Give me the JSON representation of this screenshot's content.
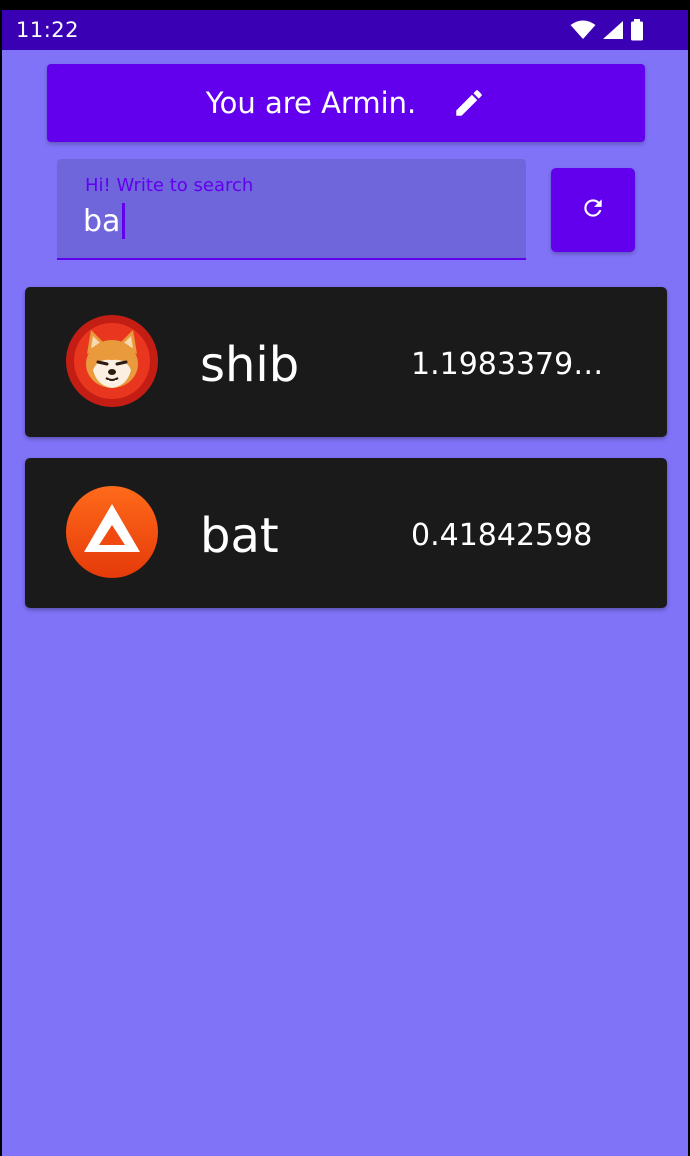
{
  "status_bar": {
    "time": "11:22",
    "icons": [
      "wifi-icon",
      "signal-icon",
      "battery-icon"
    ]
  },
  "header": {
    "name_label": "You are Armin.",
    "edit_icon": "pencil-icon"
  },
  "search": {
    "label": "Hi! Write to search",
    "value": "ba"
  },
  "refresh": {
    "icon": "refresh-icon"
  },
  "coins": [
    {
      "name": "shib",
      "price": "1.1983379E…",
      "logo": "shiba-inu-logo"
    },
    {
      "name": "bat",
      "price": "0.41842598",
      "logo": "bat-triangle-logo"
    }
  ],
  "colors": {
    "background": "#8073F8",
    "status_bar": "#3A00B4",
    "primary": "#6200EE",
    "search_fill": "#7066DC",
    "card": "#1A1A1A"
  }
}
